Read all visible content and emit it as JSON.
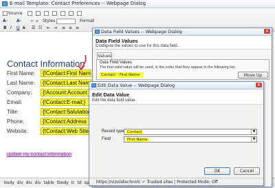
{
  "back_window": {
    "title": "E-mail Template: Contact Preferences -- Webpage Dialog",
    "toolbar": {
      "source_label": "Source",
      "styles_placeholder": "Styles",
      "format_placeholder": "Format"
    },
    "heading": "Contact Information",
    "fields": [
      {
        "label": "First Name:",
        "value": "{!Contact:First Name;}"
      },
      {
        "label": "Last Name:",
        "value": "{!Contact:Last Name;}"
      },
      {
        "label": "Company:",
        "value": "{!Account:Account Name;}"
      },
      {
        "label": "Email:",
        "value": "{!Contact:E-mail;}"
      },
      {
        "label": "Title:",
        "value": "{!Contact:Salutation;}"
      },
      {
        "label": "Phone:",
        "value": "{!Contact:Address 1;}"
      },
      {
        "label": "Website:",
        "value": "{!Contact:Web Site;}"
      }
    ],
    "link_text": "update my contact information",
    "status_path": "body  div  div  div  table  tbody  tr  td  span"
  },
  "dialog1": {
    "title": "Data Field Values -- Webpage Dialog",
    "header": "Data Field Values",
    "subheader": "Configure the values to use for this data field.",
    "tab": "Values",
    "group_label": "Data Field Values",
    "group_desc": "The first valid value will be used, in the order that they appear in the following list.",
    "list_item": "Contact : First Name",
    "move_up": "Move Up"
  },
  "dialog2": {
    "title": "Edit Data Value -- Webpage Dialog",
    "header": "Edit Data Value",
    "subheader": "Edit the data field value.",
    "record_type_label": "Record type",
    "record_type_value": "Contact",
    "field_label": "Field",
    "field_value": "First Name",
    "ok": "OK",
    "cancel": "Cancel",
    "status_url": "https://vizolatechnolc",
    "status_trusted": "Trusted sites | Protected Mode: Off"
  },
  "colors": {
    "placeholder_bg": "#ffff33",
    "heading": "#1f3f7a",
    "arrow": "#e0262b"
  }
}
